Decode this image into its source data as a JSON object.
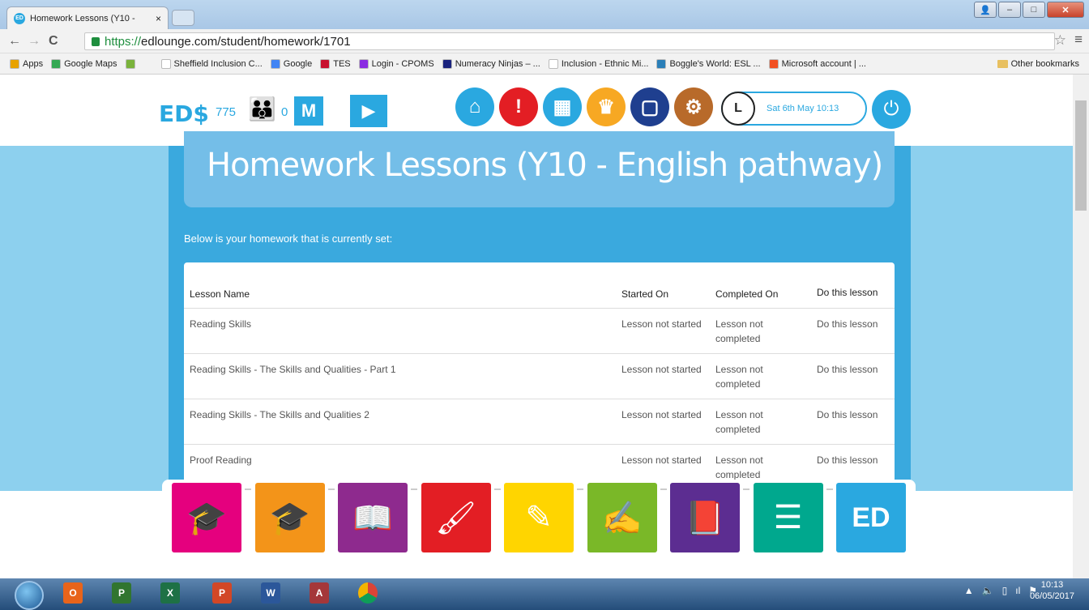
{
  "browser": {
    "tab_title": "Homework Lessons (Y10 -",
    "tab_close": "×",
    "url_protocol": "https://",
    "url_rest": "edlounge.com/student/homework/1701",
    "bookmarks": [
      {
        "label": "Apps",
        "color": "#e8a200"
      },
      {
        "label": "Google Maps",
        "color": "#34a853"
      },
      {
        "label": "",
        "color": "#7ab33b"
      },
      {
        "label": "Sheffield Inclusion C...",
        "color": "#ffffff"
      },
      {
        "label": "Google",
        "color": "#4285f4"
      },
      {
        "label": "TES",
        "color": "#c8102e"
      },
      {
        "label": "Login - CPOMS",
        "color": "#8a2be2"
      },
      {
        "label": "Numeracy Ninjas – ...",
        "color": "#1a237e"
      },
      {
        "label": "Inclusion - Ethnic Mi...",
        "color": "#ffffff"
      },
      {
        "label": "Boggle's World: ESL ...",
        "color": "#2a7fb8"
      },
      {
        "label": "Microsoft account | ...",
        "color": "#f25022"
      }
    ],
    "other_bookmarks": "Other bookmarks"
  },
  "header": {
    "logo": "ED$",
    "coins": "775",
    "people_count": "0",
    "m_label": "M",
    "datetime": "Sat 6th May 10:13",
    "icons": [
      {
        "name": "home-icon",
        "color": "#2aa8e0",
        "glyph": "⌂"
      },
      {
        "name": "alert-icon",
        "color": "#e31e24",
        "glyph": "!"
      },
      {
        "name": "calendar-icon",
        "color": "#2aa8e0",
        "glyph": "▦"
      },
      {
        "name": "trophy-icon",
        "color": "#f7a823",
        "glyph": "♛"
      },
      {
        "name": "chat-icon",
        "color": "#1f3f8f",
        "glyph": "▢"
      },
      {
        "name": "settings-icon",
        "color": "#b86a2a",
        "glyph": "⚙"
      }
    ]
  },
  "main": {
    "title": "Homework Lessons (Y10 - English pathway)",
    "intro": "Below is your homework that is currently set:",
    "columns": [
      "Lesson Name",
      "Started On",
      "Completed On",
      "Do this lesson"
    ],
    "rows": [
      {
        "name": "Reading Skills",
        "started": "Lesson not started",
        "completed": "Lesson not completed",
        "action": "Do this lesson"
      },
      {
        "name": "Reading Skills - The Skills and Qualities - Part 1",
        "started": "Lesson not started",
        "completed": "Lesson not completed",
        "action": "Do this lesson"
      },
      {
        "name": "Reading Skills - The Skills and Qualities 2",
        "started": "Lesson not started",
        "completed": "Lesson not completed",
        "action": "Do this lesson"
      },
      {
        "name": "Proof Reading",
        "started": "Lesson not started",
        "completed": "Lesson not completed",
        "action": "Do this lesson"
      }
    ]
  },
  "tiles": [
    {
      "name": "graduates-tile",
      "color": "#e5007e",
      "glyph": "🎓"
    },
    {
      "name": "mortarboard-tile",
      "color": "#f39419",
      "glyph": "🎓"
    },
    {
      "name": "reading-tile",
      "color": "#8e2a8e",
      "glyph": "📖"
    },
    {
      "name": "art-tile",
      "color": "#e31e24",
      "glyph": "🖌"
    },
    {
      "name": "writing-tile",
      "color": "#ffd500",
      "glyph": "✎"
    },
    {
      "name": "study-tile",
      "color": "#7ab828",
      "glyph": "✍"
    },
    {
      "name": "book-tile",
      "color": "#5c2d91",
      "glyph": "📕"
    },
    {
      "name": "checklist-tile",
      "color": "#00a88e",
      "glyph": "☰"
    },
    {
      "name": "ed-tile",
      "color": "#2aa8e0",
      "glyph": "ED"
    }
  ],
  "taskbar": {
    "time": "10:13",
    "date": "06/05/2017"
  }
}
